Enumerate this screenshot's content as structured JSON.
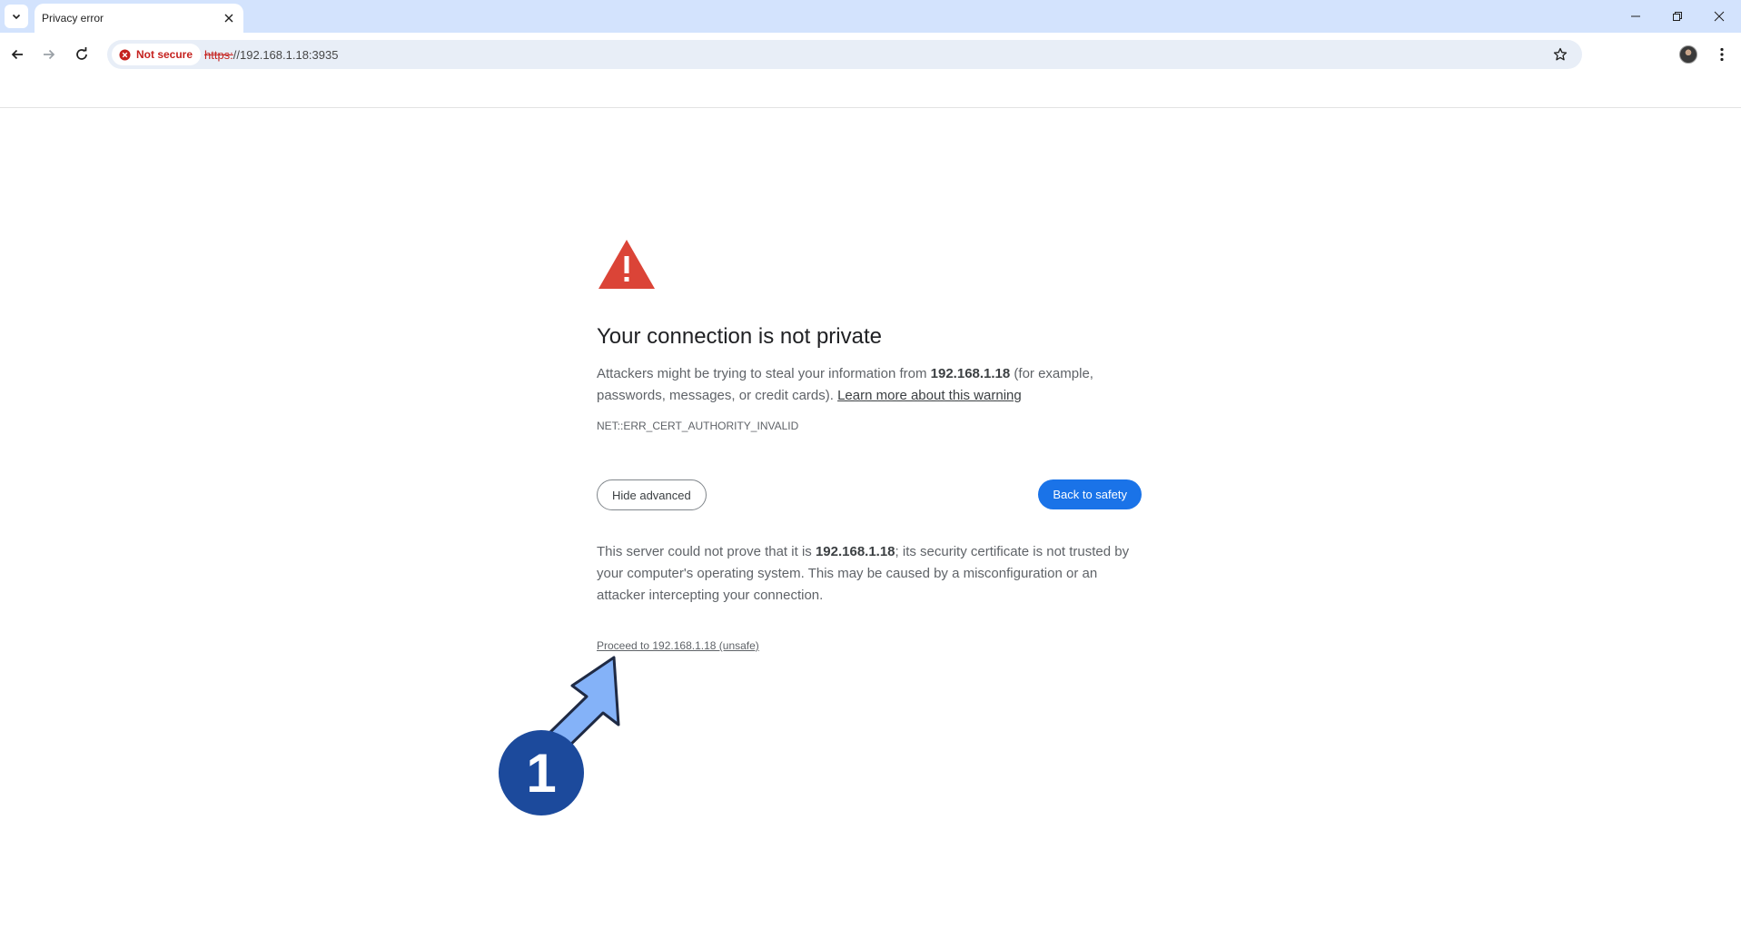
{
  "tab": {
    "title": "Privacy error"
  },
  "toolbar": {
    "security_chip_label": "Not secure",
    "url_scheme": "https:",
    "url_rest": "//192.168.1.18:3935"
  },
  "interstitial": {
    "heading": "Your connection is not private",
    "explanation_pre": "Attackers might be trying to steal your information from ",
    "explanation_host": "192.168.1.18",
    "explanation_post": " (for example, passwords, messages, or credit cards). ",
    "learn_more_label": "Learn more about this warning",
    "error_code": "NET::ERR_CERT_AUTHORITY_INVALID",
    "hide_advanced_label": "Hide advanced",
    "back_to_safety_label": "Back to safety",
    "details_pre": "This server could not prove that it is ",
    "details_host": "192.168.1.18",
    "details_post": "; its security certificate is not trusted by your computer's operating system. This may be caused by a misconfiguration or an attacker intercepting your connection.",
    "proceed_label": "Proceed to 192.168.1.18 (unsafe)"
  },
  "annotation": {
    "step_number": "1"
  },
  "colors": {
    "tabstrip": "#d3e3fd",
    "danger": "#c5221f",
    "warning_triangle": "#db4437",
    "primary_button": "#1a73e8",
    "callout_arrow": "#84b2f8",
    "callout_badge": "#1c4a9c"
  },
  "icons": {
    "tab_search": "chevron-down-icon",
    "tab_close": "close-icon",
    "back": "arrow-left-icon",
    "forward": "arrow-right-icon",
    "reload": "reload-icon",
    "not_secure": "warning-circle-icon",
    "bookmark": "star-icon",
    "menu": "kebab-menu-icon",
    "warning": "warning-triangle-icon"
  }
}
